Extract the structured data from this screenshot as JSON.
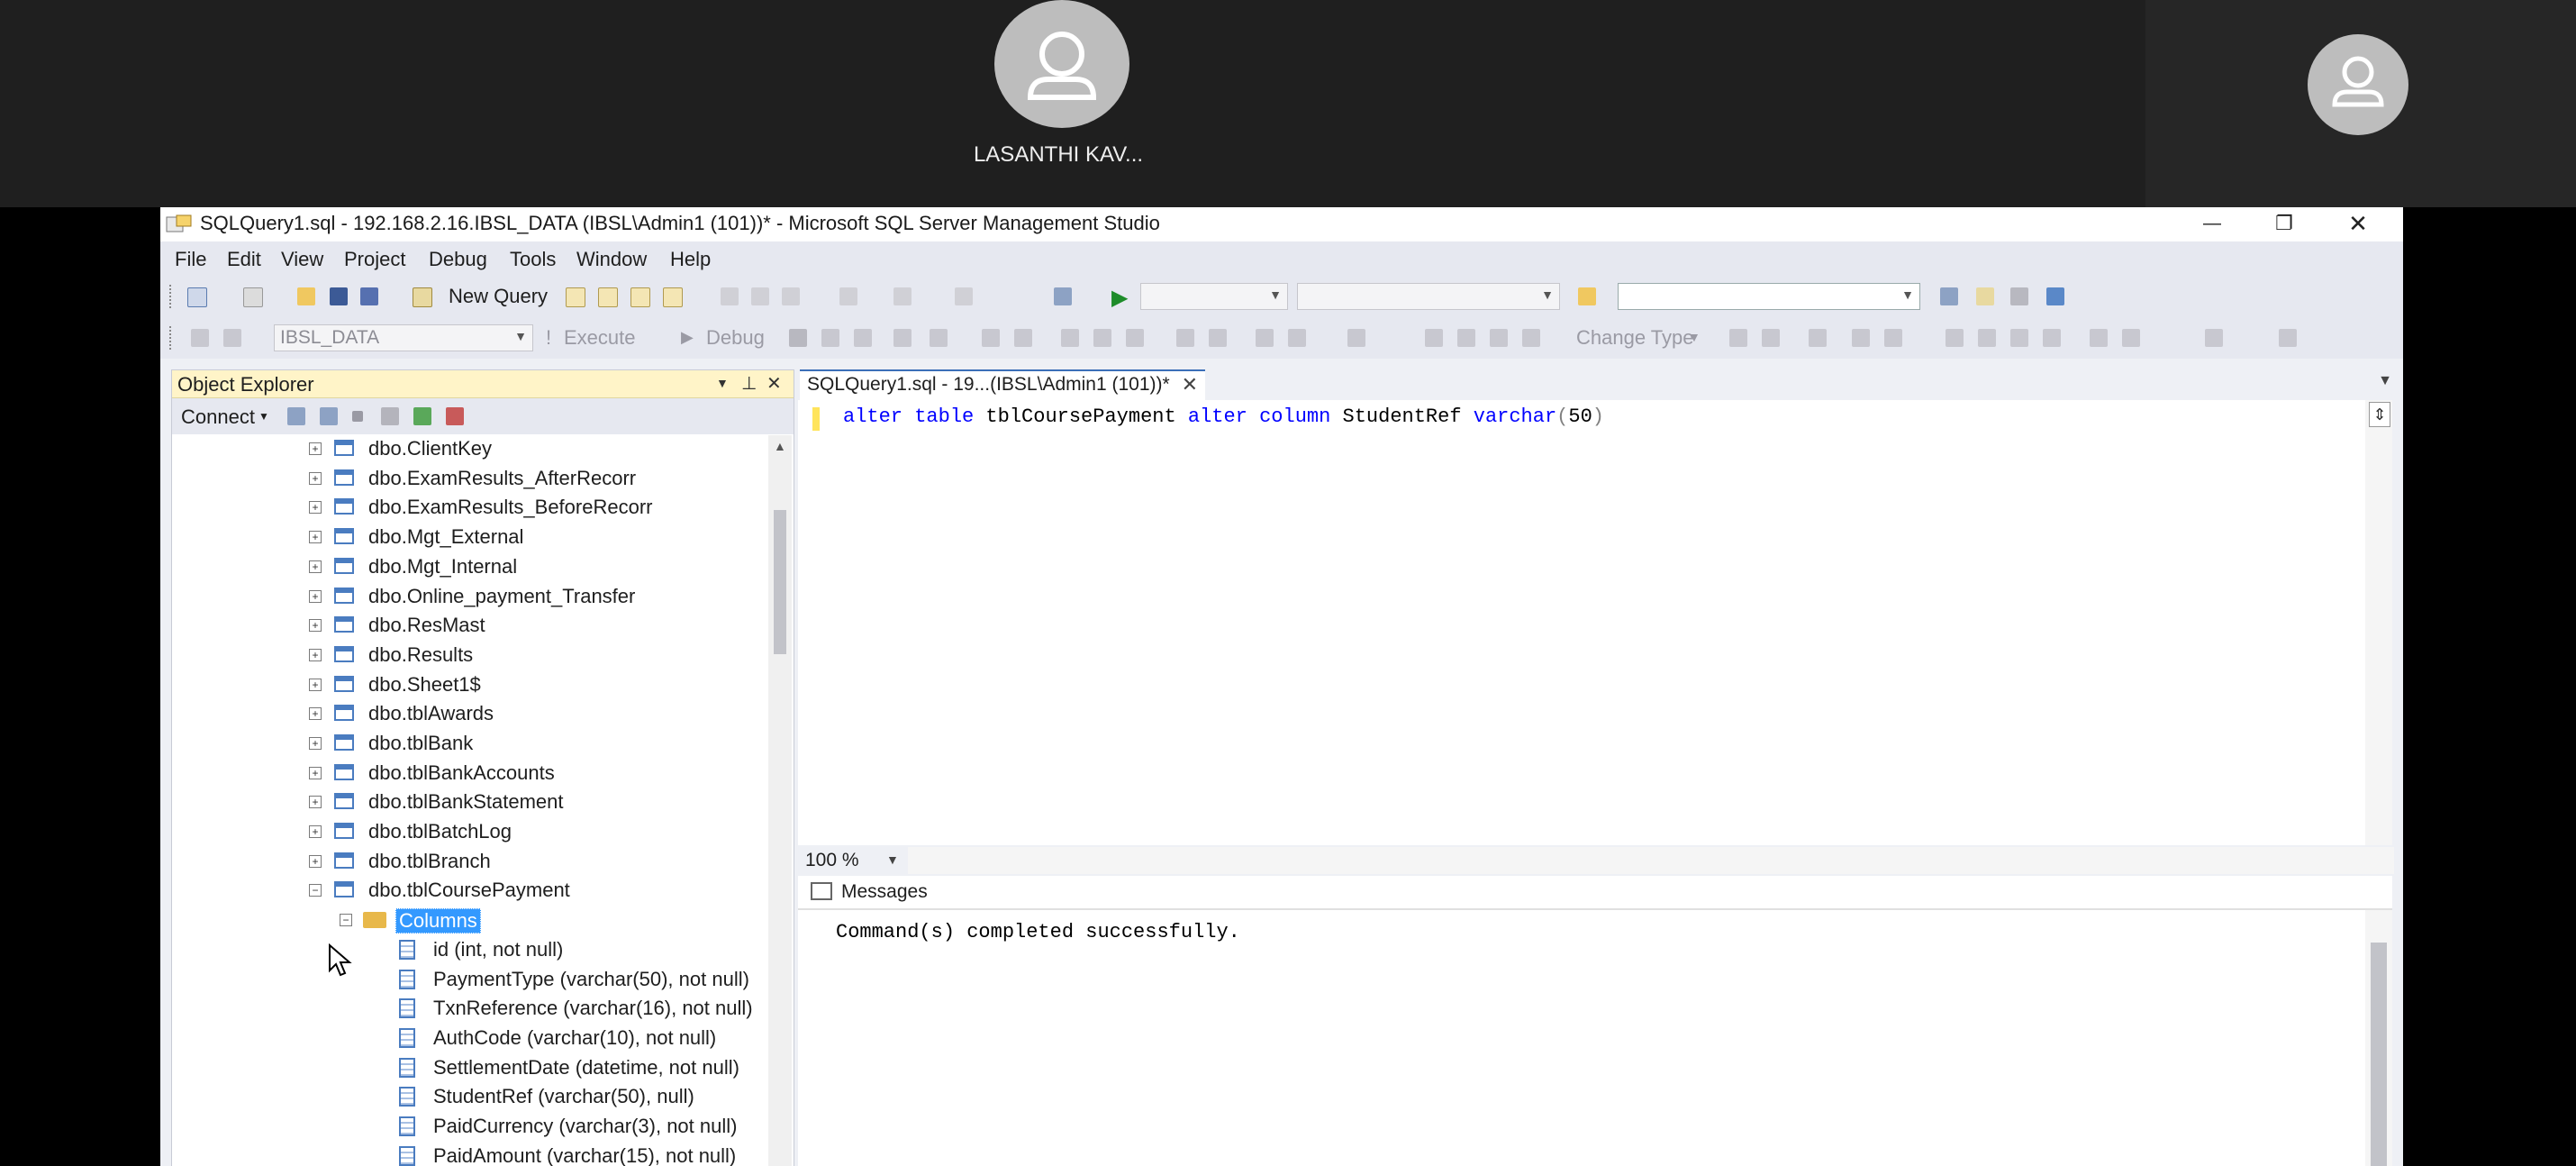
{
  "meeting": {
    "participant_name": "LASANTHI KAV..."
  },
  "window": {
    "title": "SQLQuery1.sql - 192.168.2.16.IBSL_DATA (IBSL\\Admin1 (101))* - Microsoft SQL Server Management Studio",
    "minimize": "—",
    "restore": "❐",
    "close": "✕"
  },
  "menu": [
    "File",
    "Edit",
    "View",
    "Project",
    "Debug",
    "Tools",
    "Window",
    "Help"
  ],
  "toolbar1": {
    "new_query": "New Query"
  },
  "toolbar2": {
    "database": "IBSL_DATA",
    "execute": "Execute",
    "debug": "Debug",
    "change_type": "Change Type"
  },
  "object_explorer": {
    "title": "Object Explorer",
    "connect": "Connect",
    "tables": [
      "dbo.ClientKey",
      "dbo.ExamResults_AfterRecorr",
      "dbo.ExamResults_BeforeRecorr",
      "dbo.Mgt_External",
      "dbo.Mgt_Internal",
      "dbo.Online_payment_Transfer",
      "dbo.ResMast",
      "dbo.Results",
      "dbo.Sheet1$",
      "dbo.tblAwards",
      "dbo.tblBank",
      "dbo.tblBankAccounts",
      "dbo.tblBankStatement",
      "dbo.tblBatchLog",
      "dbo.tblBranch",
      "dbo.tblCoursePayment"
    ],
    "expanded_folder": "Columns",
    "columns": [
      "id (int, not null)",
      "PaymentType (varchar(50), not null)",
      "TxnReference (varchar(16), not null)",
      "AuthCode (varchar(10), not null)",
      "SettlementDate (datetime, not null)",
      "StudentRef (varchar(50), null)",
      "PaidCurrency (varchar(3), not null)",
      "PaidAmount (varchar(15), not null)"
    ]
  },
  "editor": {
    "tab_title": "SQLQuery1.sql - 19...(IBSL\\Admin1 (101))*",
    "code": {
      "kw1": "alter table",
      "t1": " tblCoursePayment ",
      "kw2": "alter column",
      "t2": " StudentRef ",
      "kw3": "varchar",
      "p1": "(",
      "n": "50",
      "p2": ")"
    },
    "zoom": "100 %"
  },
  "results": {
    "tab": "Messages",
    "message": "Command(s) completed successfully."
  }
}
